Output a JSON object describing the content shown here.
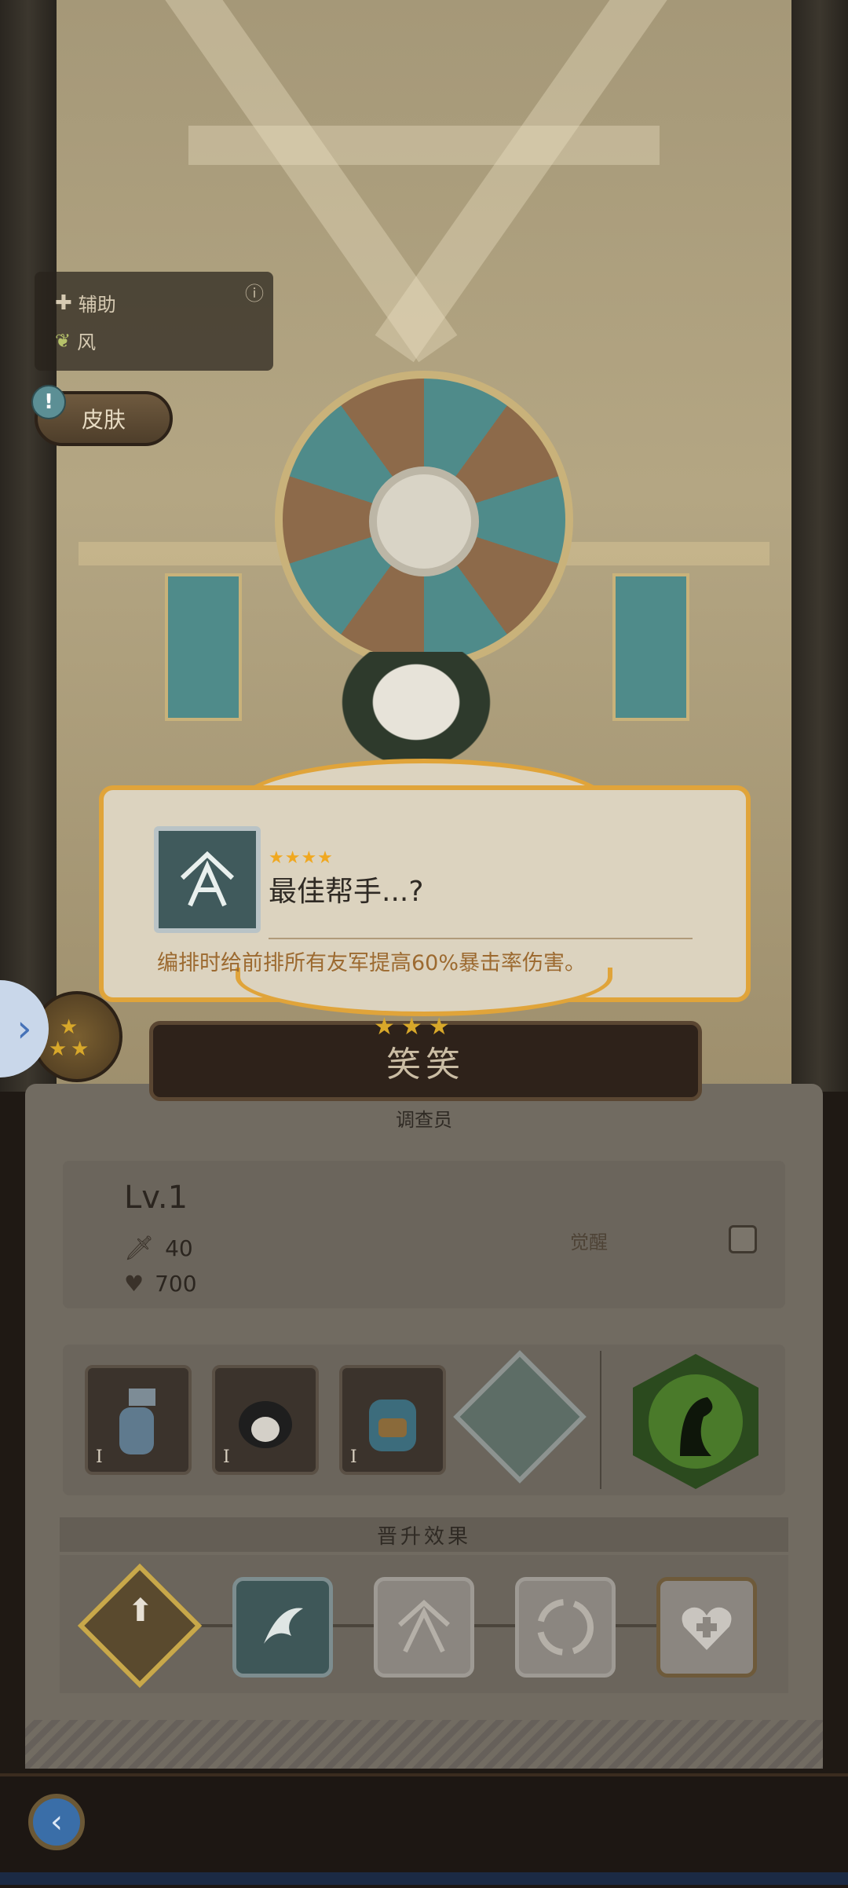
{
  "info": {
    "role_icon": "plus-icon",
    "role_label": "辅助",
    "element_icon": "leaf-icon",
    "element_label": "风",
    "info_icon": "ⓘ"
  },
  "skin": {
    "alert": "!",
    "label": "皮肤"
  },
  "popup": {
    "stars": "★★★★",
    "title": "最佳帮手...?",
    "description": "编排时给前排所有友军提高60%暴击率伤害。"
  },
  "side_arrow": "›",
  "character": {
    "name": "笑笑",
    "class": "调查员",
    "level": "Lv.1",
    "attack": "40",
    "hp": "700"
  },
  "awaken": {
    "label": "觉醒",
    "checked": false
  },
  "equipment": [
    {
      "name": "spray-bottle",
      "tier": "I"
    },
    {
      "name": "armor",
      "tier": "I"
    },
    {
      "name": "backpack",
      "tier": "I"
    }
  ],
  "advancement": {
    "title": "晋升效果"
  },
  "colors": {
    "accent": "#e0a43a",
    "panel": "#716b61",
    "back_button": "#3a6ea8"
  }
}
